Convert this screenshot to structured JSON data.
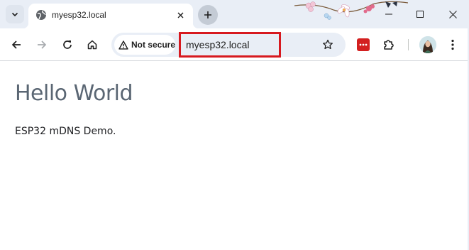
{
  "tab": {
    "title": "myesp32.local",
    "favicon": "globe-icon"
  },
  "toolbar": {
    "security_label": "Not secure",
    "url": "myesp32.local"
  },
  "page": {
    "heading": "Hello World",
    "text": "ESP32 mDNS Demo."
  },
  "colors": {
    "titlebar": "#e9eef6",
    "highlight": "#d7191f",
    "heading": "#5a6673",
    "extension": "#d32020"
  }
}
